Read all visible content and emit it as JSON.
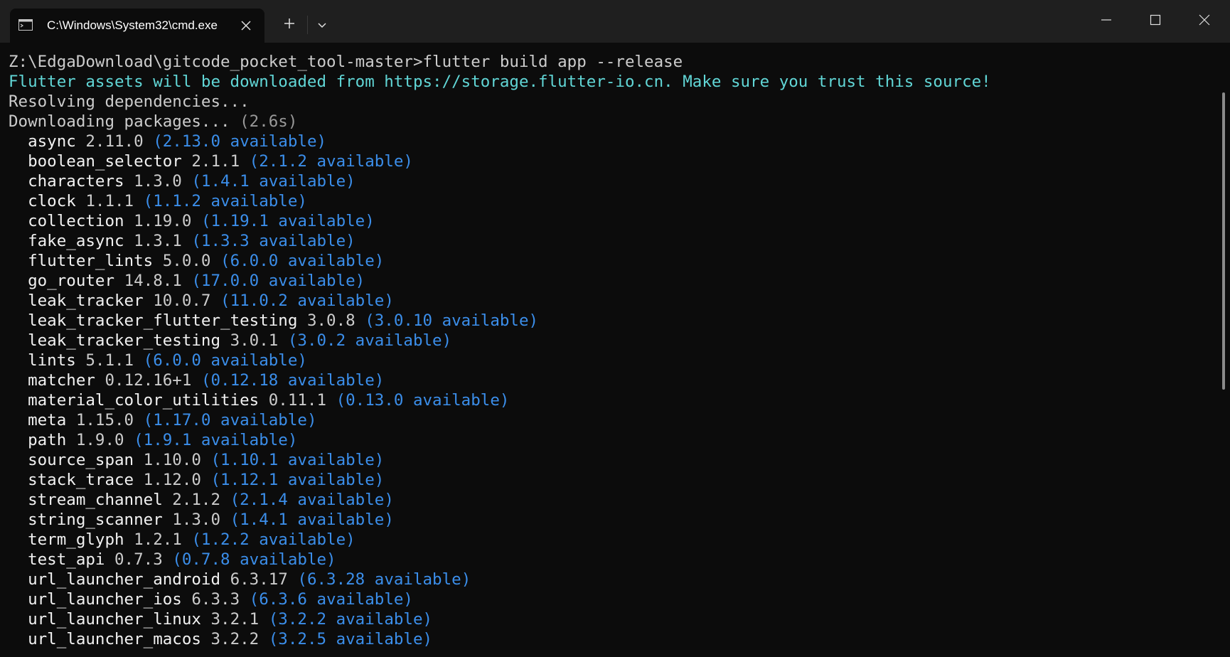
{
  "window": {
    "tab_title": "C:\\Windows\\System32\\cmd.exe",
    "icons": {
      "tab": "terminal-icon",
      "close_tab": "close-icon",
      "new_tab": "plus-icon",
      "dropdown": "chevron-down-icon",
      "minimize": "minimize-icon",
      "maximize": "maximize-icon",
      "close_window": "close-icon"
    }
  },
  "terminal": {
    "prompt": "Z:\\EdgaDownload\\gitcode_pocket_tool-master>",
    "command": "flutter build app --release",
    "info_line": "Flutter assets will be downloaded from https://storage.flutter-io.cn. Make sure you trust this source!",
    "resolving": "Resolving dependencies...",
    "downloading": "Downloading packages...",
    "downloading_time": "(2.6s)",
    "packages": [
      {
        "name": "async",
        "version": "2.11.0",
        "available": "(2.13.0 available)"
      },
      {
        "name": "boolean_selector",
        "version": "2.1.1",
        "available": "(2.1.2 available)"
      },
      {
        "name": "characters",
        "version": "1.3.0",
        "available": "(1.4.1 available)"
      },
      {
        "name": "clock",
        "version": "1.1.1",
        "available": "(1.1.2 available)"
      },
      {
        "name": "collection",
        "version": "1.19.0",
        "available": "(1.19.1 available)"
      },
      {
        "name": "fake_async",
        "version": "1.3.1",
        "available": "(1.3.3 available)"
      },
      {
        "name": "flutter_lints",
        "version": "5.0.0",
        "available": "(6.0.0 available)"
      },
      {
        "name": "go_router",
        "version": "14.8.1",
        "available": "(17.0.0 available)"
      },
      {
        "name": "leak_tracker",
        "version": "10.0.7",
        "available": "(11.0.2 available)"
      },
      {
        "name": "leak_tracker_flutter_testing",
        "version": "3.0.8",
        "available": "(3.0.10 available)"
      },
      {
        "name": "leak_tracker_testing",
        "version": "3.0.1",
        "available": "(3.0.2 available)"
      },
      {
        "name": "lints",
        "version": "5.1.1",
        "available": "(6.0.0 available)"
      },
      {
        "name": "matcher",
        "version": "0.12.16+1",
        "available": "(0.12.18 available)"
      },
      {
        "name": "material_color_utilities",
        "version": "0.11.1",
        "available": "(0.13.0 available)"
      },
      {
        "name": "meta",
        "version": "1.15.0",
        "available": "(1.17.0 available)"
      },
      {
        "name": "path",
        "version": "1.9.0",
        "available": "(1.9.1 available)"
      },
      {
        "name": "source_span",
        "version": "1.10.0",
        "available": "(1.10.1 available)"
      },
      {
        "name": "stack_trace",
        "version": "1.12.0",
        "available": "(1.12.1 available)"
      },
      {
        "name": "stream_channel",
        "version": "2.1.2",
        "available": "(2.1.4 available)"
      },
      {
        "name": "string_scanner",
        "version": "1.3.0",
        "available": "(1.4.1 available)"
      },
      {
        "name": "term_glyph",
        "version": "1.2.1",
        "available": "(1.2.2 available)"
      },
      {
        "name": "test_api",
        "version": "0.7.3",
        "available": "(0.7.8 available)"
      },
      {
        "name": "url_launcher_android",
        "version": "6.3.17",
        "available": "(6.3.28 available)"
      },
      {
        "name": "url_launcher_ios",
        "version": "6.3.3",
        "available": "(6.3.6 available)"
      },
      {
        "name": "url_launcher_linux",
        "version": "3.2.1",
        "available": "(3.2.2 available)"
      },
      {
        "name": "url_launcher_macos",
        "version": "3.2.2",
        "available": "(3.2.5 available)"
      }
    ]
  },
  "colors": {
    "background": "#0c0c0c",
    "titlebar": "#1f1f1f",
    "text": "#cccccc",
    "bright_white": "#f2f2f2",
    "cyan": "#61d6d6",
    "blue": "#3b8eea",
    "grey": "#999999"
  }
}
